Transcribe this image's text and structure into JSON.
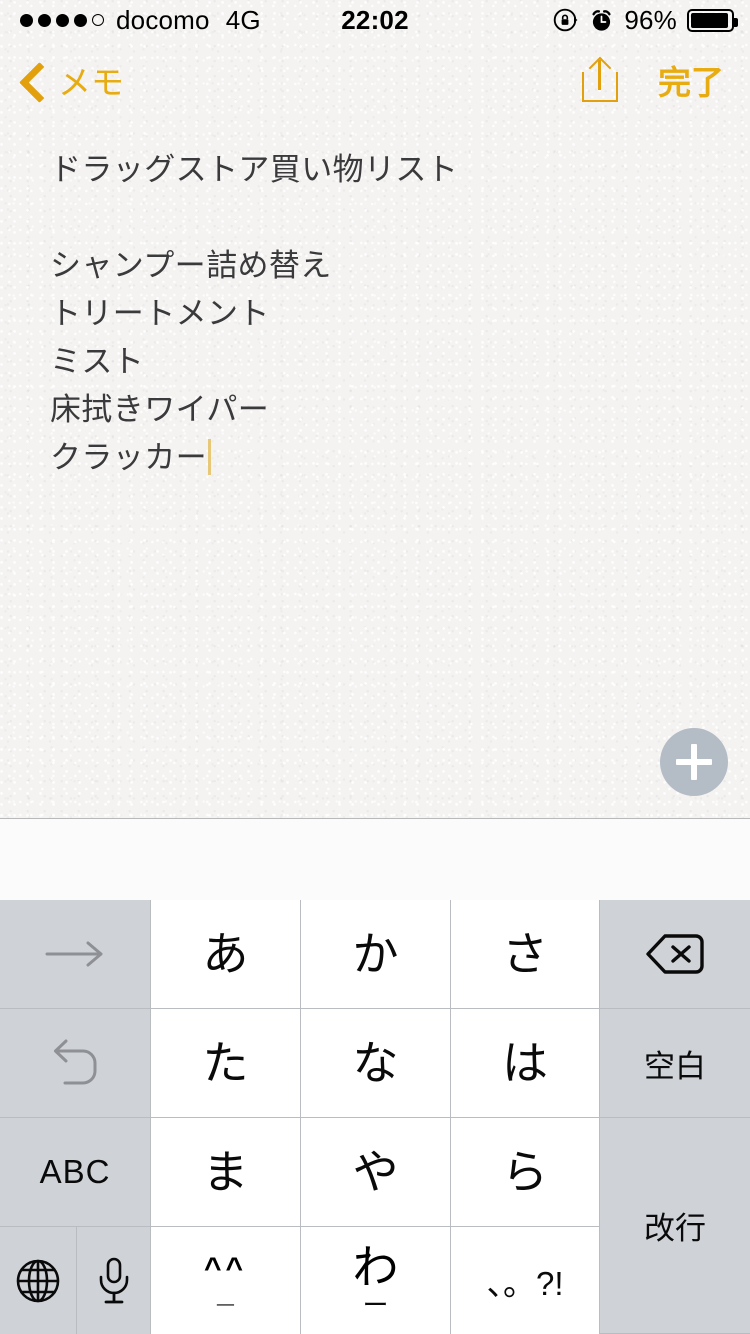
{
  "status_bar": {
    "signal_dots_filled": 4,
    "signal_dots_total": 5,
    "carrier": "docomo",
    "network": "4G",
    "time": "22:02",
    "battery_percent": "96%",
    "battery_level": 96,
    "rotation_lock_icon": "rotation-lock-icon",
    "alarm_icon": "alarm-clock-icon"
  },
  "nav_bar": {
    "back_label": "メモ",
    "back_icon": "chevron-left-icon",
    "share_icon": "share-icon",
    "done_label": "完了",
    "accent_color": "#e8ac13"
  },
  "note": {
    "title": "ドラッグストア買い物リスト",
    "lines": [
      "ドラッグストア買い物リスト",
      "",
      "シャンプー詰め替え",
      "トリートメント",
      "ミスト",
      "床拭きワイパー",
      "クラッカー"
    ],
    "cursor_after_line": 6,
    "cursor_color": "#e6c878",
    "paper_color": "#f4f3f1",
    "text_color": "#3a3a3c",
    "add_button": {
      "icon": "plus-icon",
      "color": "#b4bcc6"
    }
  },
  "candidate_bar": {
    "suggestions": []
  },
  "keyboard": {
    "type": "japanese-kana-12key",
    "key_bg": "#ffffff",
    "fn_key_bg": "#cfd3d8",
    "dim_color": "#8e9095",
    "rows": [
      {
        "keys": [
          {
            "name": "next-candidate-key",
            "label": "→",
            "icon": "arrow-right-icon",
            "kind": "fn",
            "dim": true
          },
          {
            "name": "kana-key-a",
            "label": "あ",
            "kind": "kana"
          },
          {
            "name": "kana-key-ka",
            "label": "か",
            "kind": "kana"
          },
          {
            "name": "kana-key-sa",
            "label": "さ",
            "kind": "kana"
          },
          {
            "name": "delete-key",
            "label": "",
            "icon": "backspace-icon",
            "kind": "fn"
          }
        ]
      },
      {
        "keys": [
          {
            "name": "undo-key",
            "label": "",
            "icon": "undo-arrow-icon",
            "kind": "fn",
            "dim": true
          },
          {
            "name": "kana-key-ta",
            "label": "た",
            "kind": "kana"
          },
          {
            "name": "kana-key-na",
            "label": "な",
            "kind": "kana"
          },
          {
            "name": "kana-key-ha",
            "label": "は",
            "kind": "kana"
          },
          {
            "name": "space-key",
            "label": "空白",
            "kind": "fn"
          }
        ]
      },
      {
        "keys": [
          {
            "name": "abc-mode-key",
            "label": "ABC",
            "kind": "fn"
          },
          {
            "name": "kana-key-ma",
            "label": "ま",
            "kind": "kana"
          },
          {
            "name": "kana-key-ya",
            "label": "や",
            "kind": "kana"
          },
          {
            "name": "kana-key-ra",
            "label": "ら",
            "kind": "kana"
          },
          {
            "name": "return-key",
            "label": "改行",
            "kind": "fn",
            "double_height": true
          }
        ]
      },
      {
        "keys": [
          {
            "name": "globe-key",
            "label": "",
            "icon": "globe-icon",
            "kind": "fn"
          },
          {
            "name": "dictation-key",
            "label": "",
            "icon": "microphone-icon",
            "kind": "fn"
          },
          {
            "name": "emoticon-key",
            "label": "^_^",
            "label_top": "^^",
            "label_bottom": "_",
            "kind": "kana"
          },
          {
            "name": "kana-key-wa",
            "label": "わ",
            "label_sub": "ー",
            "kind": "kana"
          },
          {
            "name": "punctuation-key",
            "label": "、。?!",
            "kind": "kana"
          }
        ]
      }
    ]
  }
}
